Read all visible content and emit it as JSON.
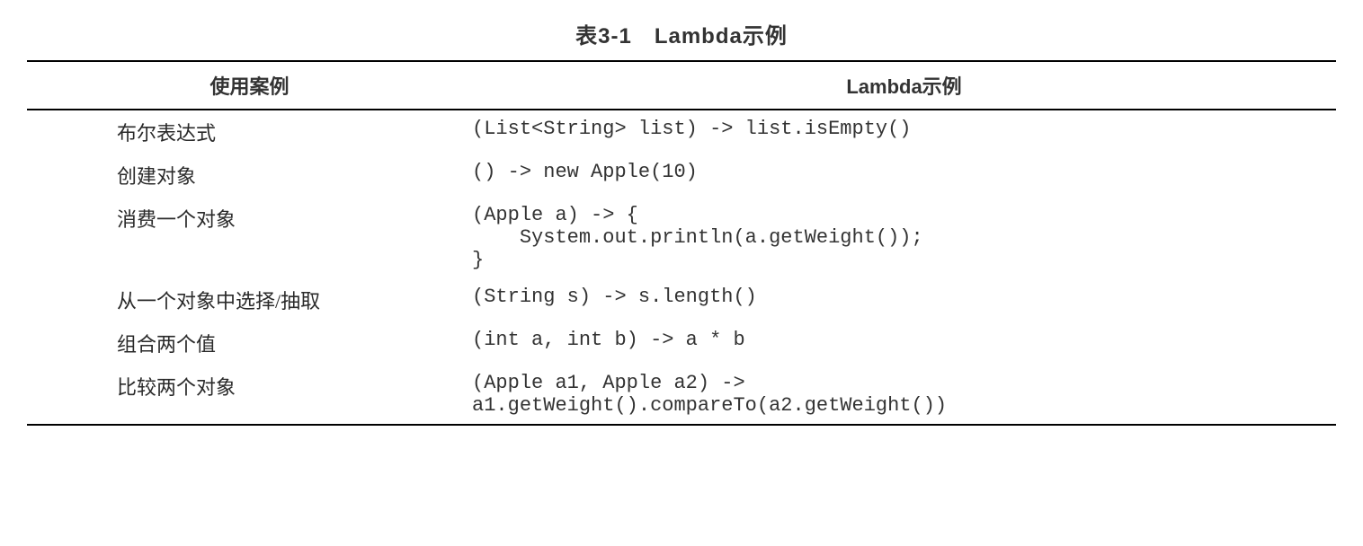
{
  "caption": "表3-1　Lambda示例",
  "headers": {
    "usecase": "使用案例",
    "example": "Lambda示例"
  },
  "rows": [
    {
      "usecase": "布尔表达式",
      "example": "(List<String> list) -> list.isEmpty()"
    },
    {
      "usecase": "创建对象",
      "example": "() -> new Apple(10)"
    },
    {
      "usecase": "消费一个对象",
      "example": "(Apple a) -> {\n    System.out.println(a.getWeight());\n}"
    },
    {
      "usecase": "从一个对象中选择/抽取",
      "example": "(String s) -> s.length()"
    },
    {
      "usecase": "组合两个值",
      "example": "(int a, int b) -> a * b"
    },
    {
      "usecase": "比较两个对象",
      "example": "(Apple a1, Apple a2) ->\na1.getWeight().compareTo(a2.getWeight())"
    }
  ]
}
